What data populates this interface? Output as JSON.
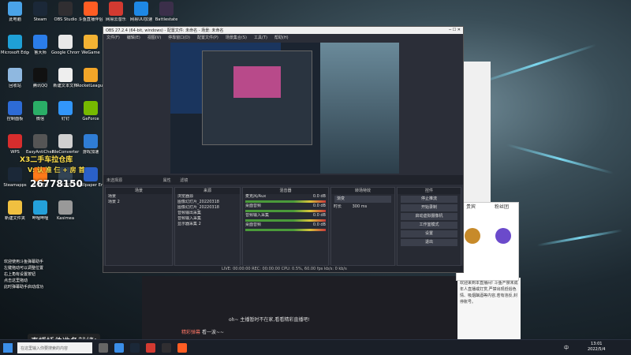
{
  "desktop": {
    "icons": [
      {
        "label": "此电脑",
        "color": "#4aa3e8"
      },
      {
        "label": "Steam",
        "color": "#1b2838"
      },
      {
        "label": "OBS Studio",
        "color": "#302e31"
      },
      {
        "label": "斗鱼直播伴侣",
        "color": "#ff5d23"
      },
      {
        "label": "网易云音乐",
        "color": "#d33a31"
      },
      {
        "label": "网易UU加速",
        "color": "#1e88e5"
      },
      {
        "label": "Battlestate",
        "color": "#3b2f4a"
      },
      {
        "label": "Microsoft Edge",
        "color": "#1fa0d7"
      },
      {
        "label": "鲁大师",
        "color": "#2b7de9"
      },
      {
        "label": "Google Chrome",
        "color": "#e8e8e8"
      },
      {
        "label": "WeGame",
        "color": "#f2b233"
      },
      {
        "label": "回收站",
        "color": "#8fb8e0"
      },
      {
        "label": "腾讯QQ",
        "color": "#111"
      },
      {
        "label": "新建文本文档",
        "color": "#eee"
      },
      {
        "label": "RocketLeague",
        "color": "#f3a628"
      },
      {
        "label": "控制面板",
        "color": "#2d6bd6"
      },
      {
        "label": "微信",
        "color": "#2aae67"
      },
      {
        "label": "钉钉",
        "color": "#3296fa"
      },
      {
        "label": "GeForce",
        "color": "#76b900"
      },
      {
        "label": "WPS",
        "color": "#d72d2d"
      },
      {
        "label": "EasyAntiCheat",
        "color": "#555"
      },
      {
        "label": "FileConverter",
        "color": "#d0d0d0"
      },
      {
        "label": "游戏加速",
        "color": "#2f7dd6"
      },
      {
        "label": "Steamapps",
        "color": "#1b2838"
      },
      {
        "label": "快手直播",
        "color": "#ff7a1a"
      },
      {
        "label": "2022年",
        "color": "#345"
      },
      {
        "label": "Wallpaper Engine",
        "color": "#2a60c8"
      },
      {
        "label": "新建文件夹",
        "color": "#f0c040"
      },
      {
        "label": "哔哩哔哩",
        "color": "#24a0da"
      },
      {
        "label": "Kasimea",
        "color": "#999"
      }
    ],
    "overlay_line1": "X3二手车拉仓库",
    "overlay_line2": "V: 认 准 仨 + 房 首",
    "overlay_number": "26778150",
    "overlay_bottom": "直播插件准备就绪!",
    "sidebar_text": [
      "欢迎使用斗鱼弹幕助手",
      "左键拖动可以调整位置",
      "右上角有设置按钮",
      "点击这里拖动",
      "此时弹幕助手启动成功"
    ]
  },
  "obs": {
    "title": "OBS 27.2.4 (64-bit, windows) - 配置文件: 未命名 - 场景: 未命名",
    "menu": [
      "文件(F)",
      "编辑(E)",
      "视图(V)",
      "停靠窗口(D)",
      "配置文件(P)",
      "场景集合(S)",
      "工具(T)",
      "帮助(H)"
    ],
    "selected_source": "未选择源",
    "props_btn": "属性",
    "filters_btn": "滤镜",
    "docks": {
      "scenes": {
        "title": "场景",
        "items": [
          "场景",
          "场景 2"
        ]
      },
      "sources": {
        "title": "来源",
        "items": [
          "浏览器源",
          "图像幻灯片_20220318",
          "图像幻灯片_20220318",
          "音频输出采集",
          "音频输入采集",
          "显示器采集 2"
        ]
      },
      "mixer": {
        "title": "混音器",
        "channels": [
          {
            "name": "麦克风/Aux",
            "db": "0.0 dB"
          },
          {
            "name": "桌面音频",
            "db": "0.0 dB"
          },
          {
            "name": "音频输入采集",
            "db": "0.0 dB"
          },
          {
            "name": "桌面音频",
            "db": "0.0 dB"
          }
        ]
      },
      "transitions": {
        "title": "转场特效",
        "type": "渐变",
        "duration_label": "时长",
        "duration": "300 ms"
      },
      "controls": {
        "title": "控件",
        "buttons": [
          "停止推流",
          "开始录制",
          "启动虚拟摄像机",
          "工作室模式",
          "设置",
          "退出"
        ]
      }
    },
    "status": "LIVE: 00:00:00  REC: 00:00:00  CPU: 0.5%, 60.00 fps  kb/s: 0 kb/s"
  },
  "chat": {
    "tabs": [
      "贵宾",
      "粉丝团"
    ],
    "badges": [
      "主播",
      "超管"
    ]
  },
  "room": {
    "sys_msg": "欢迎来到本直播间! 斗鱼严禁未成年人直播或打赏,严禁出现低俗色情、吸烟酗酒等内容,若有违反,封停账号。",
    "msg": "oh~ 主播暂时不在家,看看精彩直播吧!",
    "chat_user": "精彩弹幕",
    "chat_text": "看一波~~"
  },
  "taskbar": {
    "search_placeholder": "在这里输入你要搜索的内容",
    "time": "13:01",
    "date": "2022/5/4",
    "lang": "中"
  },
  "dock_tabs": [
    "场景",
    "来源",
    "混音器",
    "转场特效",
    "控件"
  ]
}
